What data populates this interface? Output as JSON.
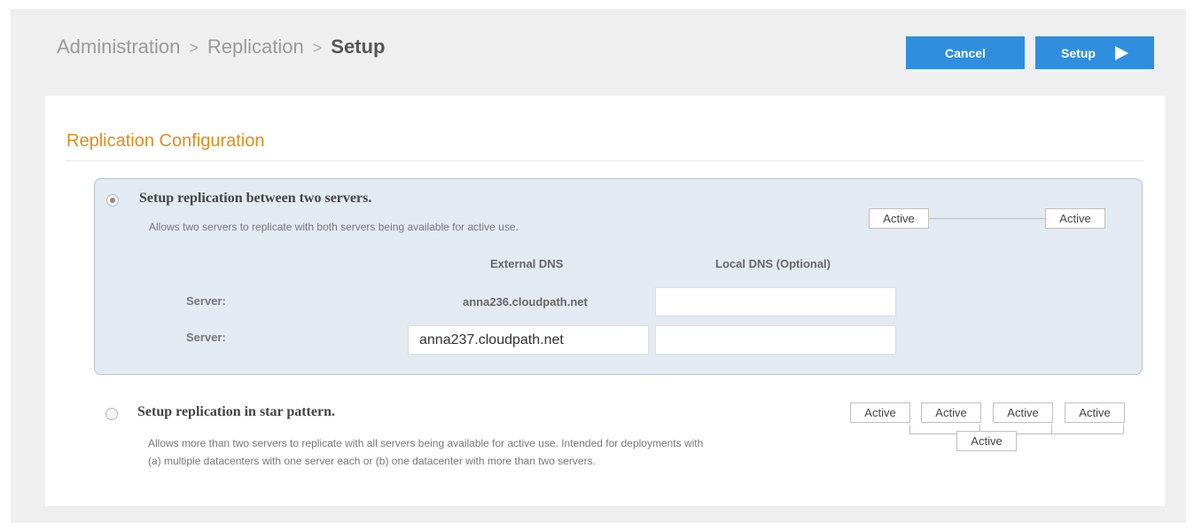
{
  "breadcrumb": {
    "items": [
      "Administration",
      "Replication"
    ],
    "separator": ">",
    "current": "Setup"
  },
  "header": {
    "cancel_label": "Cancel",
    "setup_label": "Setup"
  },
  "section": {
    "title": "Replication Configuration"
  },
  "option_two_servers": {
    "selected": true,
    "title": "Setup replication between two servers.",
    "description": "Allows two servers to replicate with both servers being available for active use.",
    "diagram": [
      "Active",
      "Active"
    ],
    "table": {
      "col_external": "External DNS",
      "col_local": "Local DNS (Optional)",
      "rows": [
        {
          "label": "Server:",
          "external_dns": "anna236.cloudpath.net",
          "local_dns": ""
        },
        {
          "label": "Server:",
          "external_dns": "anna237.cloudpath.net",
          "local_dns": ""
        }
      ]
    }
  },
  "option_star": {
    "selected": false,
    "title": "Setup replication in star pattern.",
    "description_line1": "Allows more than two servers to replicate with all servers being available for active use. Intended for deployments with",
    "description_line2": "(a) multiple datacenters with one server each or (b) one datacenter with more than two servers.",
    "diagram_top": [
      "Active",
      "Active",
      "Active",
      "Active"
    ],
    "diagram_center": "Active"
  },
  "colors": {
    "accent_blue": "#2f8fde",
    "section_orange": "#e38b1a",
    "panel_bg": "#e3eaf1"
  }
}
